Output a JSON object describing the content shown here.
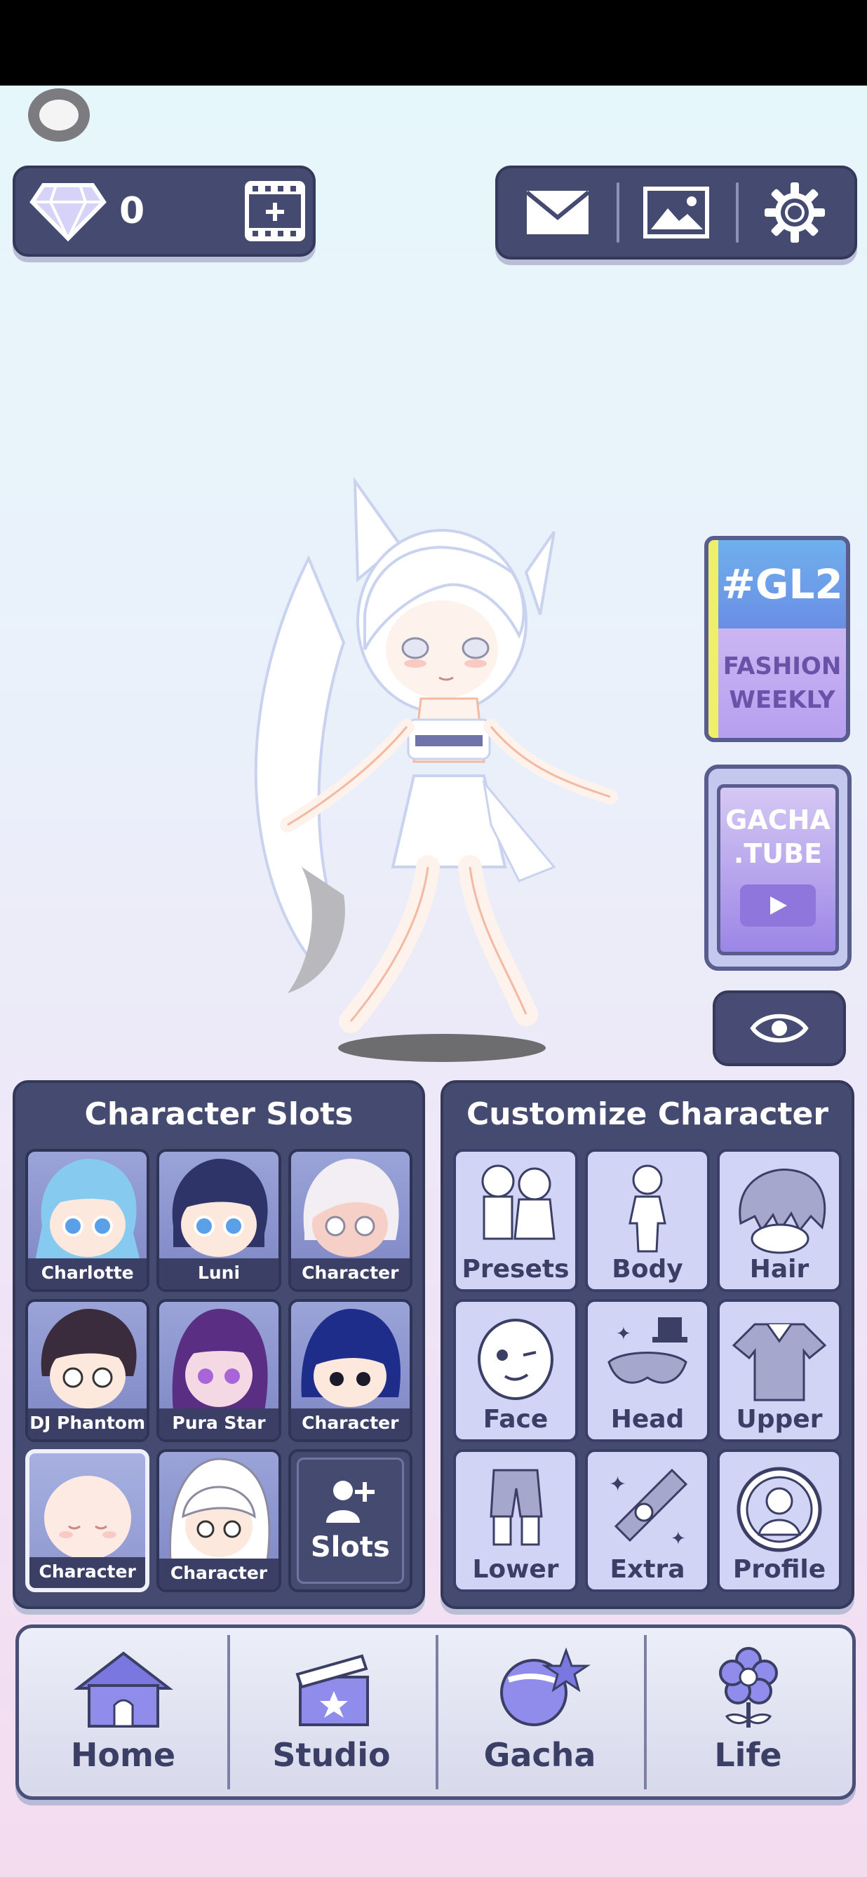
{
  "currency": {
    "gems": "0"
  },
  "character_slots": {
    "title": "Character Slots",
    "slots": [
      {
        "label": "Charlotte",
        "hair": "#86cbef",
        "skin": "#fde8dd",
        "eyes": "#5aa0e8"
      },
      {
        "label": "Luni",
        "hair": "#2f3468",
        "skin": "#fde8dd",
        "eyes": "#5aa0e8"
      },
      {
        "label": "Character",
        "hair": "#f2eef4",
        "skin": "#f6d0c6",
        "eyes": "#ffffff"
      },
      {
        "label": "DJ Phantom",
        "hair": "#3a2c3c",
        "skin": "#fde8dd",
        "eyes": "#ffffff"
      },
      {
        "label": "Pura Star",
        "hair": "#5a2e82",
        "skin": "#f4d8e4",
        "eyes": "#a865d8"
      },
      {
        "label": "Character",
        "hair": "#1e2c8a",
        "skin": "#fde8dd",
        "eyes": "#1a1a2a"
      },
      {
        "label": "Character",
        "hair": "none",
        "skin": "#fdebe3",
        "eyes": "closed"
      },
      {
        "label": "Character",
        "hair": "#ffffff",
        "skin": "#fde8dd",
        "eyes": "#ffffff"
      }
    ],
    "add_label": "Slots"
  },
  "customize": {
    "title": "Customize Character",
    "options": [
      {
        "label": "Presets",
        "icon": "presets-icon"
      },
      {
        "label": "Body",
        "icon": "body-icon"
      },
      {
        "label": "Hair",
        "icon": "hair-icon"
      },
      {
        "label": "Face",
        "icon": "face-icon"
      },
      {
        "label": "Head",
        "icon": "head-icon"
      },
      {
        "label": "Upper",
        "icon": "upper-icon"
      },
      {
        "label": "Lower",
        "icon": "lower-icon"
      },
      {
        "label": "Extra",
        "icon": "extra-icon"
      },
      {
        "label": "Profile",
        "icon": "profile-icon"
      }
    ]
  },
  "side_banners": {
    "gl2": {
      "line1": "#GL2",
      "line2": "FASHION",
      "line3": "WEEKLY"
    },
    "gacha_tube": {
      "line1": "GACHA",
      "line2": ".TUBE"
    }
  },
  "nav": [
    {
      "label": "Home",
      "icon": "house-icon"
    },
    {
      "label": "Studio",
      "icon": "clapperboard-icon"
    },
    {
      "label": "Gacha",
      "icon": "gacha-ball-icon"
    },
    {
      "label": "Life",
      "icon": "flower-icon"
    }
  ],
  "colors": {
    "panel": "#454a70",
    "accent": "#6e64d8",
    "tile": "#d2d4f6"
  }
}
